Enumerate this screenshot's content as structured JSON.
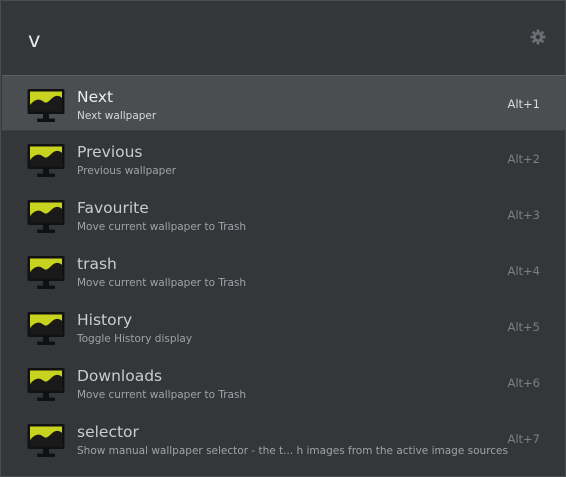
{
  "search": {
    "query": "v"
  },
  "settings_icon": "gear-icon",
  "results": [
    {
      "name": "Next",
      "description": "Next wallpaper",
      "shortcut": "Alt+1",
      "icon": "monitor-wallpaper-icon",
      "selected": true
    },
    {
      "name": "Previous",
      "description": "Previous wallpaper",
      "shortcut": "Alt+2",
      "icon": "monitor-wallpaper-icon",
      "selected": false
    },
    {
      "name": "Favourite",
      "description": "Move current wallpaper to Trash",
      "shortcut": "Alt+3",
      "icon": "monitor-wallpaper-icon",
      "selected": false
    },
    {
      "name": "trash",
      "description": "Move current wallpaper to Trash",
      "shortcut": "Alt+4",
      "icon": "monitor-wallpaper-icon",
      "selected": false
    },
    {
      "name": "History",
      "description": "Toggle History display",
      "shortcut": "Alt+5",
      "icon": "monitor-wallpaper-icon",
      "selected": false
    },
    {
      "name": "Downloads",
      "description": "Move current wallpaper to Trash",
      "shortcut": "Alt+6",
      "icon": "monitor-wallpaper-icon",
      "selected": false
    },
    {
      "name": "selector",
      "description": "Show manual wallpaper selector - the t... h images from the active image sources",
      "shortcut": "Alt+7",
      "icon": "monitor-wallpaper-icon",
      "selected": false
    }
  ],
  "colors": {
    "accent_icon": "#c8d320",
    "background": "#34373a",
    "selected_row": "#4a4e51"
  }
}
